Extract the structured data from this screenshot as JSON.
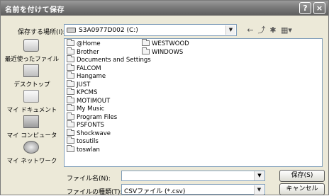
{
  "window": {
    "title": "名前を付けて保存",
    "help_glyph": "?",
    "close_glyph": "×"
  },
  "toolbar": {
    "savein_label": "保存する場所(I):",
    "savein_value": "S3A0977D002 (C:)",
    "back_glyph": "←",
    "up_glyph": "⤴",
    "newfolder_glyph": "✱",
    "views_glyph": "▦▾"
  },
  "places": [
    {
      "label": "最近使ったファイル",
      "icon": "recent-documents-icon"
    },
    {
      "label": "デスクトップ",
      "icon": "desktop-icon"
    },
    {
      "label": "マイ ドキュメント",
      "icon": "my-documents-icon"
    },
    {
      "label": "マイ コンピュータ",
      "icon": "my-computer-icon"
    },
    {
      "label": "マイ ネットワーク",
      "icon": "my-network-icon"
    }
  ],
  "files": {
    "col1": [
      "@Home",
      "Brother",
      "Documents and Settings",
      "FALCOM",
      "Hangame",
      "JUST",
      "KPCMS",
      "MOTIMOUT",
      "My Music",
      "Program Files",
      "PSFONTS",
      "Shockwave",
      "tosutils",
      "toswlan"
    ],
    "col2": [
      "WESTWOOD",
      "WINDOWS"
    ]
  },
  "form": {
    "filename_label": "ファイル名(N):",
    "filename_value": "",
    "filetype_label": "ファイルの種類(T):",
    "filetype_value": "CSVファイル (*.csv)",
    "save_button": "保存(S)",
    "cancel_button": "キャンセル"
  }
}
